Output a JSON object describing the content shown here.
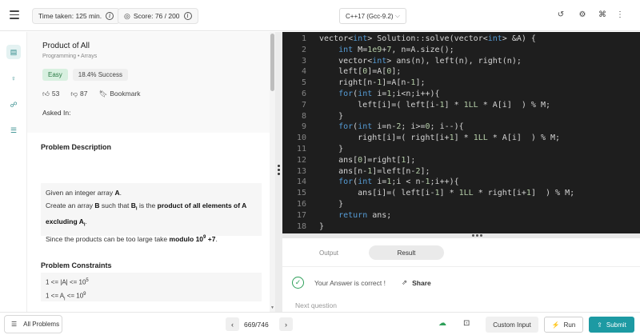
{
  "topbar": {
    "time_label": "Time taken: 125 min.",
    "score_label": "Score:",
    "score_value": "76 / 200",
    "language": "C++17 (Gcc-9.2)"
  },
  "problem": {
    "title": "Product of All",
    "subtitle": "Programming • Arrays",
    "difficulty": "Easy",
    "success_rate": "18.4% Success",
    "likes": "53",
    "dislikes": "87",
    "bookmark_label": "Bookmark",
    "asked_in_label": "Asked In:",
    "description_title": "Problem Description",
    "description": {
      "line1_pre": "Given an integer array ",
      "line1_var": "A",
      "line1_post": ".",
      "line2_pre": "Create an array ",
      "line2_var": "B",
      "line2_mid": " such that ",
      "line2_bi": "B",
      "line2_sub": "i",
      "line2_is": " is the ",
      "line2_bold": "product of all elements of A",
      "line3_bold": "excluding A",
      "line3_sub": "i",
      "line3_post": ".",
      "line4_pre": "Since the products can be too large take ",
      "line4_bold": "modulo 10",
      "line4_sup": "9",
      "line4_bold2": " +7",
      "line4_post": "."
    },
    "constraints_title": "Problem Constraints",
    "constraint1_pre": "1 <= |A| <= 10",
    "constraint1_sup": "5",
    "constraint2_pre": "1 <= A",
    "constraint2_sub": "i",
    "constraint2_mid": " <= 10",
    "constraint2_sup": "9"
  },
  "editor": {
    "lines": [
      {
        "n": "1",
        "segs": [
          [
            "vector<",
            ""
          ],
          [
            "int",
            "kw"
          ],
          [
            "> Solution::solve(vector<",
            ""
          ],
          [
            "int",
            "kw"
          ],
          [
            "> &A) {",
            ""
          ]
        ]
      },
      {
        "n": "2",
        "segs": [
          [
            "    ",
            ""
          ],
          [
            "int",
            "kw"
          ],
          [
            " M=",
            ""
          ],
          [
            "1e9",
            "num"
          ],
          [
            "+",
            ""
          ],
          [
            "7",
            "num"
          ],
          [
            ", n=A.size();",
            ""
          ]
        ]
      },
      {
        "n": "3",
        "segs": [
          [
            "    vector<",
            ""
          ],
          [
            "int",
            "kw"
          ],
          [
            "> ans(n), left(n), right(n);",
            ""
          ]
        ]
      },
      {
        "n": "4",
        "segs": [
          [
            "    left[",
            ""
          ],
          [
            "0",
            "num"
          ],
          [
            "]=A[",
            ""
          ],
          [
            "0",
            "num"
          ],
          [
            "];",
            ""
          ]
        ]
      },
      {
        "n": "5",
        "segs": [
          [
            "    right[n-",
            ""
          ],
          [
            "1",
            "num"
          ],
          [
            "]=A[n-",
            ""
          ],
          [
            "1",
            "num"
          ],
          [
            "];",
            ""
          ]
        ]
      },
      {
        "n": "6",
        "segs": [
          [
            "    ",
            ""
          ],
          [
            "for",
            "kw"
          ],
          [
            "(",
            ""
          ],
          [
            "int",
            "kw"
          ],
          [
            " i=",
            ""
          ],
          [
            "1",
            "num"
          ],
          [
            ";i<n;i++){",
            ""
          ]
        ]
      },
      {
        "n": "7",
        "segs": [
          [
            "        left[i]=( left[i-",
            ""
          ],
          [
            "1",
            "num"
          ],
          [
            "] * ",
            ""
          ],
          [
            "1LL",
            "num"
          ],
          [
            " * A[i]  ) % M;",
            ""
          ]
        ]
      },
      {
        "n": "8",
        "segs": [
          [
            "    }",
            ""
          ]
        ]
      },
      {
        "n": "9",
        "segs": [
          [
            "    ",
            ""
          ],
          [
            "for",
            "kw"
          ],
          [
            "(",
            ""
          ],
          [
            "int",
            "kw"
          ],
          [
            " i=n-",
            ""
          ],
          [
            "2",
            "num"
          ],
          [
            "; i>=",
            ""
          ],
          [
            "0",
            "num"
          ],
          [
            "; i--){",
            ""
          ]
        ]
      },
      {
        "n": "10",
        "segs": [
          [
            "        right[i]=( right[i+",
            ""
          ],
          [
            "1",
            "num"
          ],
          [
            "] * ",
            ""
          ],
          [
            "1LL",
            "num"
          ],
          [
            " * A[i]  ) % M;",
            ""
          ]
        ]
      },
      {
        "n": "11",
        "segs": [
          [
            "    }",
            ""
          ]
        ]
      },
      {
        "n": "12",
        "segs": [
          [
            "    ans[",
            ""
          ],
          [
            "0",
            "num"
          ],
          [
            "]=right[",
            ""
          ],
          [
            "1",
            "num"
          ],
          [
            "];",
            ""
          ]
        ]
      },
      {
        "n": "13",
        "segs": [
          [
            "    ans[n-",
            ""
          ],
          [
            "1",
            "num"
          ],
          [
            "]=left[n-",
            ""
          ],
          [
            "2",
            "num"
          ],
          [
            "];",
            ""
          ]
        ]
      },
      {
        "n": "14",
        "segs": [
          [
            "    ",
            ""
          ],
          [
            "for",
            "kw"
          ],
          [
            "(",
            ""
          ],
          [
            "int",
            "kw"
          ],
          [
            " i=",
            ""
          ],
          [
            "1",
            "num"
          ],
          [
            ";i < n-",
            ""
          ],
          [
            "1",
            "num"
          ],
          [
            ";i++){",
            ""
          ]
        ]
      },
      {
        "n": "15",
        "segs": [
          [
            "        ans[i]=( left[i-",
            ""
          ],
          [
            "1",
            "num"
          ],
          [
            "] * ",
            ""
          ],
          [
            "1LL",
            "num"
          ],
          [
            " * right[i+",
            ""
          ],
          [
            "1",
            "num"
          ],
          [
            "]  ) % M;",
            ""
          ]
        ]
      },
      {
        "n": "16",
        "segs": [
          [
            "    }",
            ""
          ]
        ]
      },
      {
        "n": "17",
        "segs": [
          [
            "    ",
            ""
          ],
          [
            "return",
            "kw"
          ],
          [
            " ans;",
            ""
          ]
        ]
      },
      {
        "n": "18",
        "segs": [
          [
            "}",
            ""
          ]
        ]
      }
    ]
  },
  "output": {
    "tab_output": "Output",
    "tab_result": "Result",
    "result_text": "Your Answer is correct !",
    "share_label": "Share",
    "next_question": "Next question"
  },
  "bottombar": {
    "all_problems": "All Problems",
    "counter": "669/746",
    "custom_input": "Custom Input",
    "run": "Run",
    "submit": "Submit"
  }
}
